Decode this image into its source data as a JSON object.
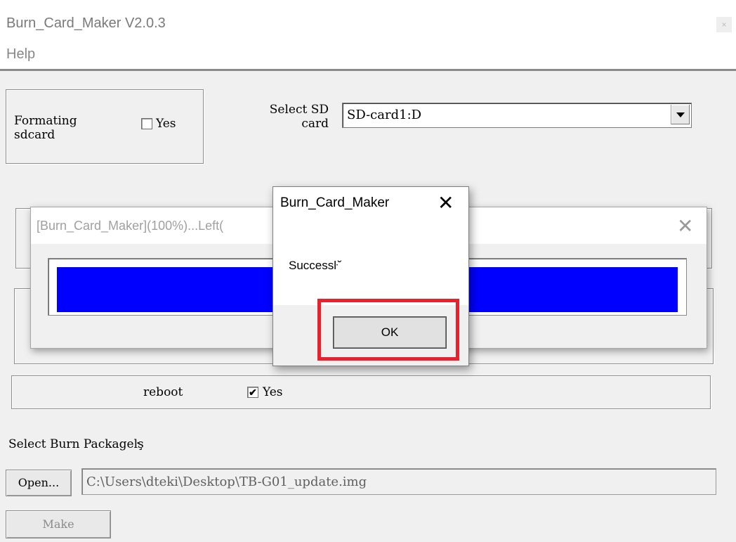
{
  "window": {
    "title": "Burn_Card_Maker V2.0.3",
    "close_glyph": "×"
  },
  "menu": {
    "help": "Help"
  },
  "format_group": {
    "label_line1": "Formating",
    "label_line2": "sdcard",
    "checkbox_label": "Yes",
    "checked": false
  },
  "sd_select": {
    "label_line1": "Select SD",
    "label_line2": "card",
    "value": "SD-card1:D"
  },
  "reboot": {
    "label": "reboot",
    "checkbox_label": "Yes",
    "checked": true,
    "check_glyph": "✔"
  },
  "package": {
    "label": "Select Burn Packageŀş",
    "open_button": "Open...",
    "path": "C:\\Users\\dteki\\Desktop\\TB-G01_update.img",
    "make_button": "Make"
  },
  "progress_dialog": {
    "title": "[Burn_Card_Maker](100%)...Left(",
    "close_glyph": "✕",
    "percent": 100,
    "fill_color": "#0000ff"
  },
  "message_box": {
    "title": "Burn_Card_Maker",
    "close_glyph": "✕",
    "message": "Successŀ˘",
    "ok_button": "OK",
    "highlight_color": "#e8212c"
  }
}
